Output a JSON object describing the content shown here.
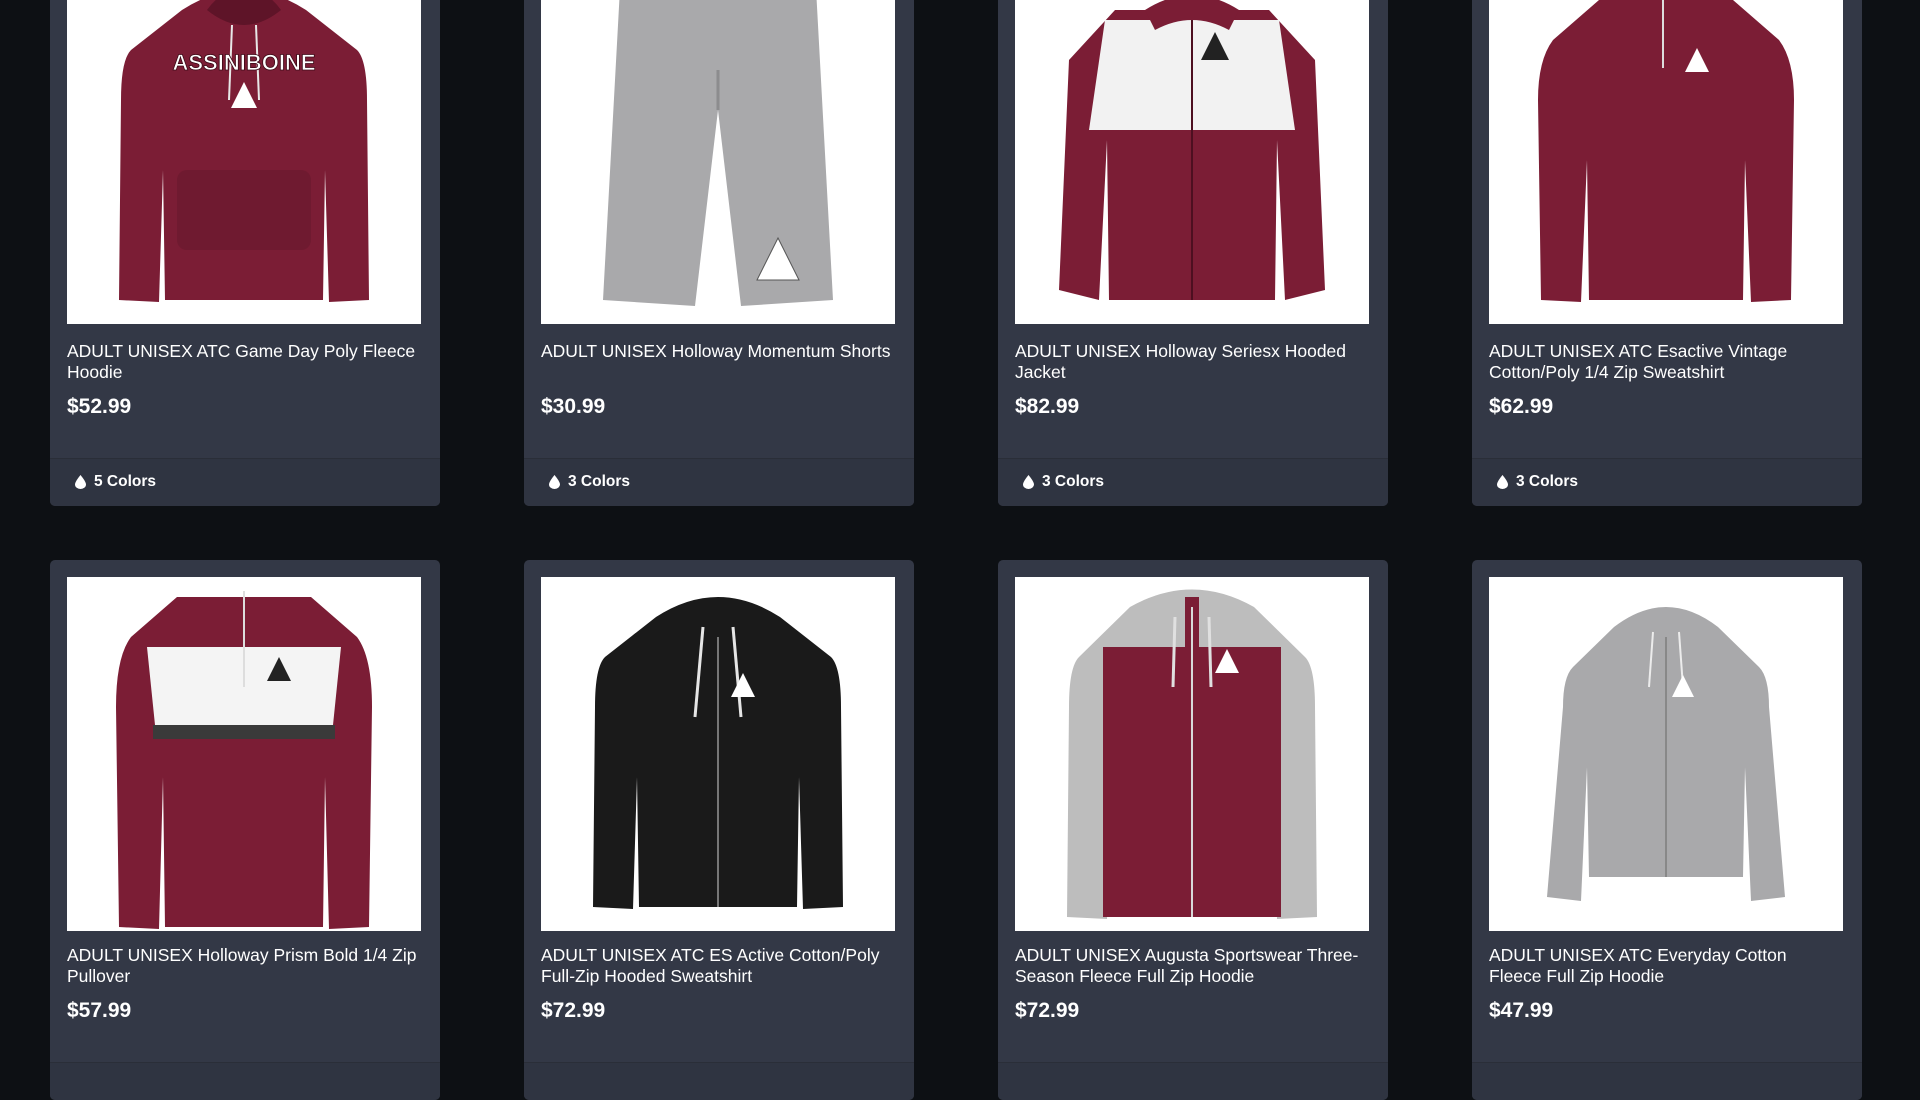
{
  "products": [
    {
      "title": "ADULT UNISEX ATC Game Day Poly Fleece Hoodie",
      "price": "$52.99",
      "colors": "5 Colors",
      "image_text": "ASSINIBOINE"
    },
    {
      "title": "ADULT UNISEX Holloway Momentum Shorts",
      "price": "$30.99",
      "colors": "3 Colors"
    },
    {
      "title": "ADULT UNISEX Holloway Seriesx Hooded Jacket",
      "price": "$82.99",
      "colors": "3 Colors"
    },
    {
      "title": "ADULT UNISEX ATC Esactive Vintage Cotton/Poly 1/4 Zip Sweatshirt",
      "price": "$62.99",
      "colors": "3 Colors"
    },
    {
      "title": "ADULT UNISEX Holloway Prism Bold 1/4 Zip Pullover",
      "price": "$57.99"
    },
    {
      "title": "ADULT UNISEX ATC ES Active Cotton/Poly Full-Zip Hooded Sweatshirt",
      "price": "$72.99"
    },
    {
      "title": "ADULT UNISEX Augusta Sportswear Three-Season Fleece Full Zip Hoodie",
      "price": "$72.99"
    },
    {
      "title": "ADULT UNISEX ATC Everyday Cotton Fleece Full Zip Hoodie",
      "price": "$47.99"
    }
  ],
  "colors": {
    "page_bg": "#0d1014",
    "card_bg": "#333846",
    "maroon": "#7b1d35",
    "grey_garment": "#a9a9ab",
    "black_garment": "#1a1a1a"
  },
  "icons": {
    "color_swatch": "drop-icon",
    "logo": "mountain-logo-icon"
  }
}
